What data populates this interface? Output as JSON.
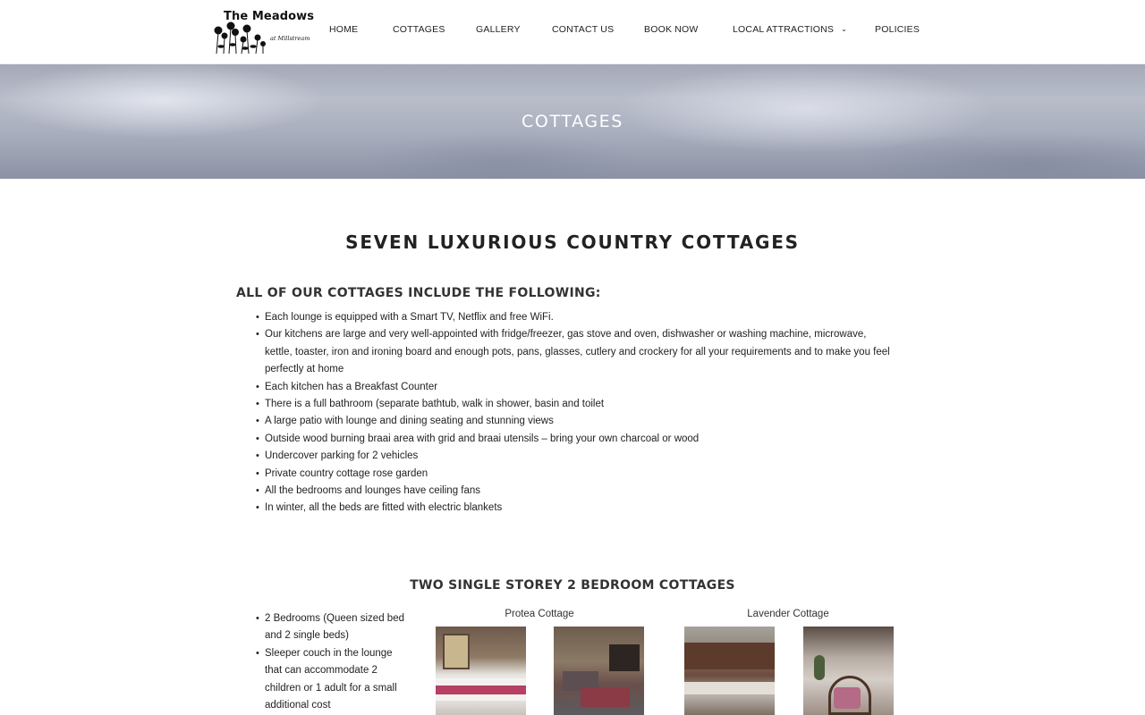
{
  "header": {
    "logo": {
      "title": "The Meadows",
      "subtitle": "at Millstream"
    },
    "nav": [
      {
        "label": "HOME"
      },
      {
        "label": "COTTAGES"
      },
      {
        "label": "GALLERY"
      },
      {
        "label": "CONTACT US"
      },
      {
        "label": "BOOK NOW"
      },
      {
        "label": "LOCAL ATTRACTIONS",
        "has_dropdown": true
      },
      {
        "label": "POLICIES"
      }
    ]
  },
  "hero": {
    "title": "COTTAGES"
  },
  "main": {
    "heading": "SEVEN LUXURIOUS COUNTRY COTTAGES",
    "includes_heading": "ALL OF OUR COTTAGES INCLUDE THE FOLLOWING:",
    "includes": [
      "Each lounge is equipped with a Smart TV, Netflix and free WiFi.",
      "Our kitchens are large and very well-appointed with fridge/freezer, gas stove and oven, dishwasher or washing machine, microwave, kettle, toaster, iron and ironing board and enough pots, pans, glasses, cutlery and crockery for all your requirements and to make you feel perfectly at home",
      "Each kitchen has a Breakfast Counter",
      "There is a full bathroom (separate bathtub, walk in shower, basin and toilet",
      "A large patio with lounge and dining seating and stunning views",
      "Outside wood burning braai area with grid and braai utensils – bring your own charcoal or wood",
      "Undercover parking for 2 vehicles",
      "Private country cottage rose garden",
      "All the bedrooms and lounges have ceiling fans",
      "In winter, all the beds are fitted with electric blankets"
    ],
    "section": {
      "title": "TWO SINGLE STOREY 2 BEDROOM COTTAGES",
      "details": [
        "2 Bedrooms (Queen sized bed and 2 single beds)",
        "Sleeper couch in the lounge that can accommodate 2 children or 1 adult for a small additional cost"
      ],
      "cottages": [
        {
          "name": "Protea Cottage"
        },
        {
          "name": "Lavender Cottage"
        }
      ]
    }
  },
  "colors": {
    "text": "#222222",
    "hero_overlay": "#a4a9b8",
    "accent_throw": "#b84064"
  }
}
